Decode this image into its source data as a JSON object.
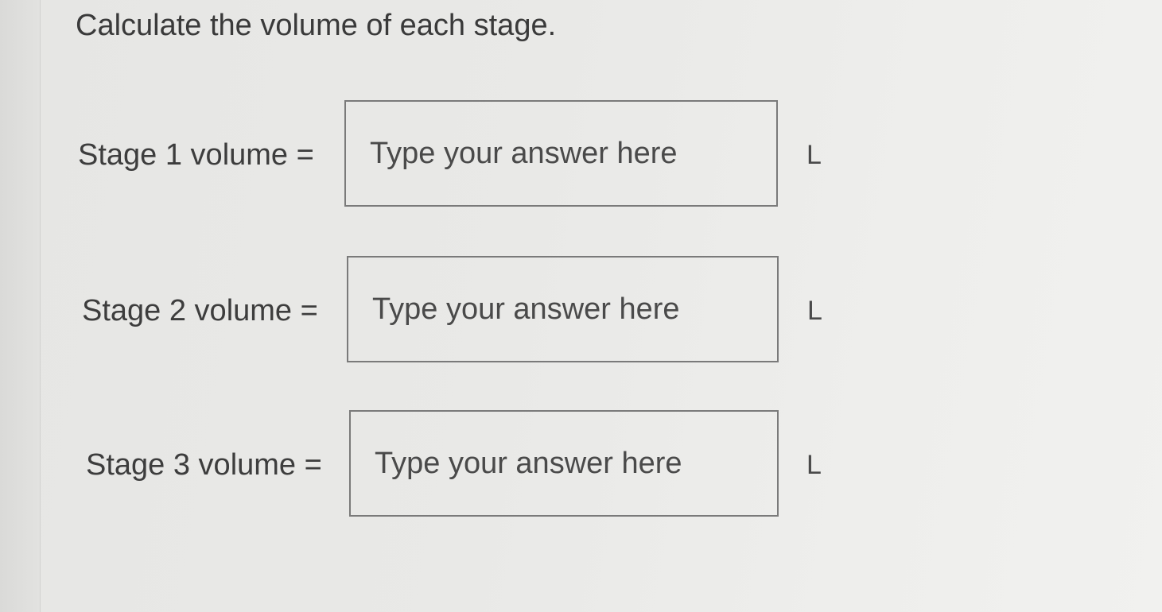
{
  "question": "Calculate the volume of each stage.",
  "stages": [
    {
      "label": "Stage 1 volume =",
      "placeholder": "Type your answer here",
      "value": "",
      "unit": "L"
    },
    {
      "label": "Stage 2 volume =",
      "placeholder": "Type your answer here",
      "value": "",
      "unit": "L"
    },
    {
      "label": "Stage 3 volume =",
      "placeholder": "Type your answer here",
      "value": "",
      "unit": "L"
    }
  ]
}
